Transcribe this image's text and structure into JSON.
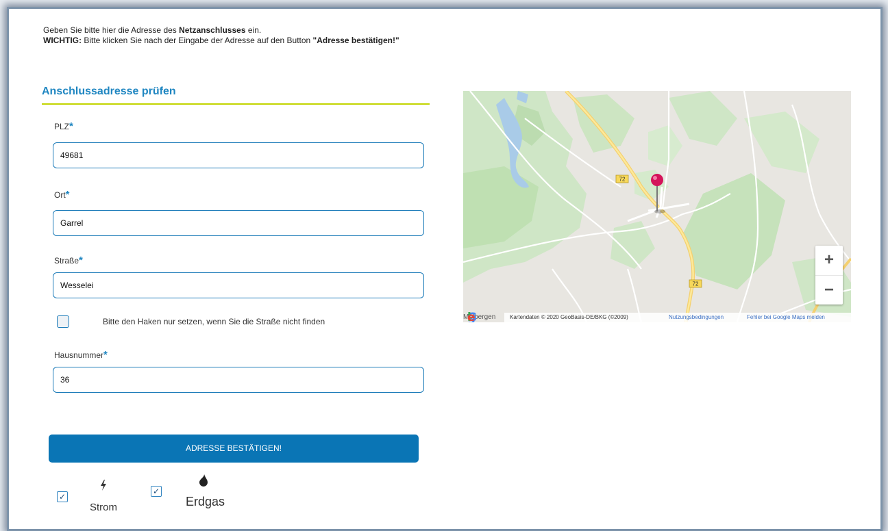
{
  "intro": {
    "line1_pre": "Geben Sie bitte hier die Adresse des ",
    "line1_bold": "Netzanschlusses",
    "line1_post": " ein.",
    "line2_label": "WICHTIG:",
    "line2_text": " Bitte klicken Sie nach der Eingabe der Adresse auf den Button ",
    "line2_button": "\"Adresse bestätigen!\""
  },
  "section": {
    "title": "Anschlussadresse prüfen"
  },
  "form": {
    "required_marker": "*",
    "plz": {
      "label": "PLZ",
      "value": "49681"
    },
    "ort": {
      "label": "Ort",
      "value": "Garrel"
    },
    "strasse": {
      "label": "Straße",
      "value": "Wesselei"
    },
    "street_not_found_checkbox": {
      "label": "Bitte den Haken nur setzen, wenn Sie die Straße nicht finden",
      "checked": false
    },
    "hausnummer": {
      "label": "Hausnummer",
      "value": "36"
    },
    "confirm_button": "ADRESSE BESTÄTIGEN!"
  },
  "services": [
    {
      "label": "Strom",
      "icon": "lightning-icon",
      "checked": true
    },
    {
      "label": "Erdgas",
      "icon": "flame-drop-icon",
      "checked": true
    }
  ],
  "map": {
    "road_label": "72",
    "zoom_in": "+",
    "zoom_out": "−",
    "city_label": "Molbergen",
    "attribution": "Kartendaten © 2020 GeoBasis-DE/BKG (©2009)",
    "terms_link": "Nutzungsbedingungen",
    "report_link": "Fehler bei Google Maps melden",
    "logo_text": [
      "G",
      "o",
      "o",
      "g",
      "l",
      "e"
    ]
  },
  "colors": {
    "accent": "#1f86c1",
    "underline": "#c2d400",
    "button": "#0a75b5",
    "frame_border": "#7d93aa"
  }
}
